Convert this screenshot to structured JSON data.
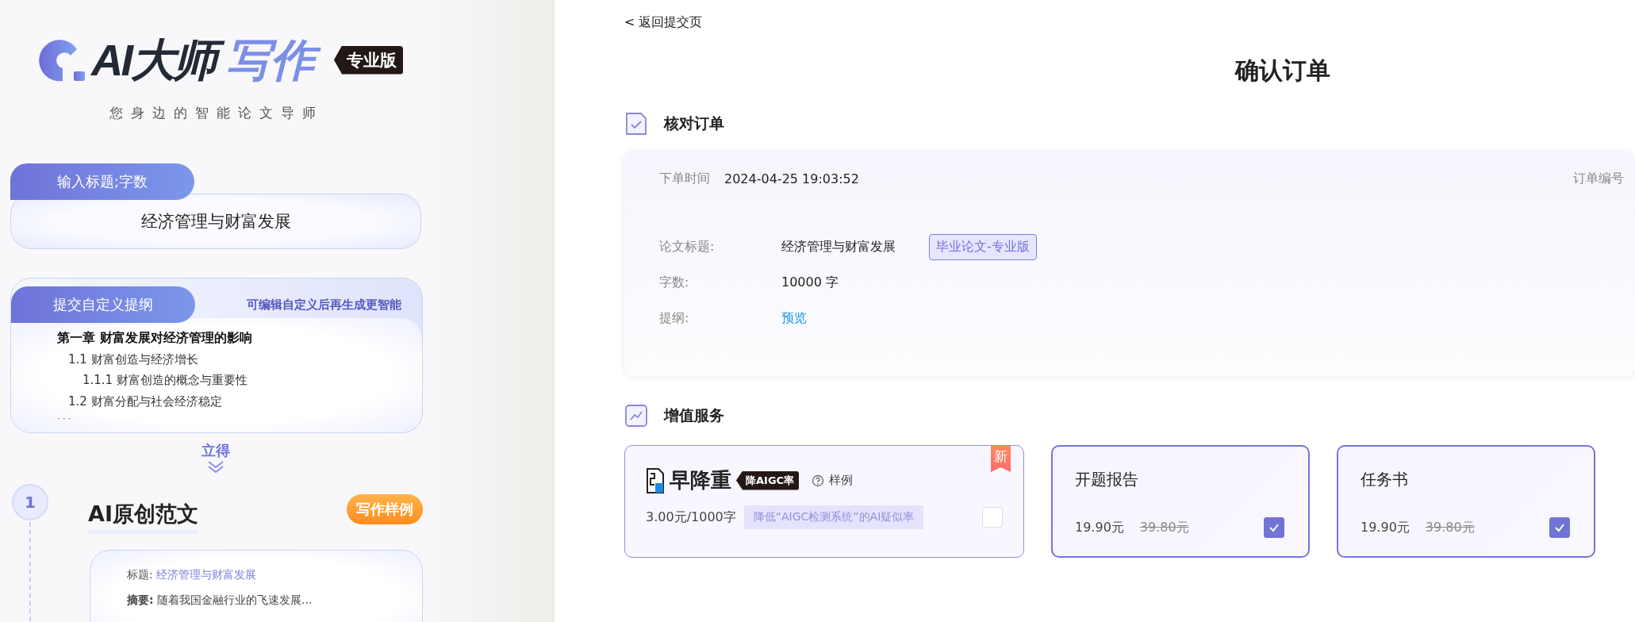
{
  "sidebar": {
    "logo": {
      "text_dark": "AI大师",
      "text_accent": "写作",
      "badge": "专业版"
    },
    "tagline": "您身边的智能论文导师",
    "title_card": {
      "tab": "输入标题;字数",
      "value": "经济管理与财富发展"
    },
    "outline_card": {
      "tab": "提交自定义提纲",
      "hint": "可编辑自定义后再生成更智能",
      "items": [
        {
          "text": "第一章 财富发展对经济管理的影响",
          "children": [
            {
              "text": "1.1 财富创造与经济增长",
              "children": [
                {
                  "text": "1.1.1 财富创造的概念与重要性"
                }
              ]
            },
            {
              "text": "1.2 财富分配与社会经济稳定"
            }
          ]
        }
      ],
      "more": "· · ·"
    },
    "arrow_label": "立得",
    "step": {
      "number": "1",
      "title": "AI原创范文",
      "badge": "写作样例",
      "sample": {
        "title_label": "标题:",
        "title_value": "经济管理与财富发展",
        "abstract": "**摘要:** 随着我国金融行业的飞速发展..."
      }
    }
  },
  "main": {
    "back_link": "< 返回提交页",
    "page_title": "确认订单",
    "check_section": {
      "title": "核对订单",
      "order_time_label": "下单时间",
      "order_time": "2024-04-25 19:03:52",
      "order_no_label": "订单编号",
      "fields": [
        {
          "label": "论文标题:",
          "value": "经济管理与财富发展",
          "tag": "毕业论文-专业版",
          "kind": "text"
        },
        {
          "label": "字数:",
          "value": "10000 字",
          "kind": "text"
        },
        {
          "label": "提纲:",
          "value": "预览",
          "kind": "link"
        }
      ]
    },
    "services_section": {
      "title": "增值服务",
      "services": [
        {
          "kind": "product",
          "brand": "早降重",
          "brand_badge": "降AIGC率",
          "sample": "样例",
          "price": "3.00元/1000字",
          "desc": "降低“AIGC检测系统”的AI疑似率",
          "ribbon": "新",
          "checked": false,
          "selected": false
        },
        {
          "kind": "plain",
          "title": "开题报告",
          "price": "19.90元",
          "old_price": "39.80元",
          "checked": true,
          "selected": true
        },
        {
          "kind": "plain",
          "title": "任务书",
          "price": "19.90元",
          "old_price": "39.80元",
          "checked": true,
          "selected": true
        }
      ]
    }
  }
}
